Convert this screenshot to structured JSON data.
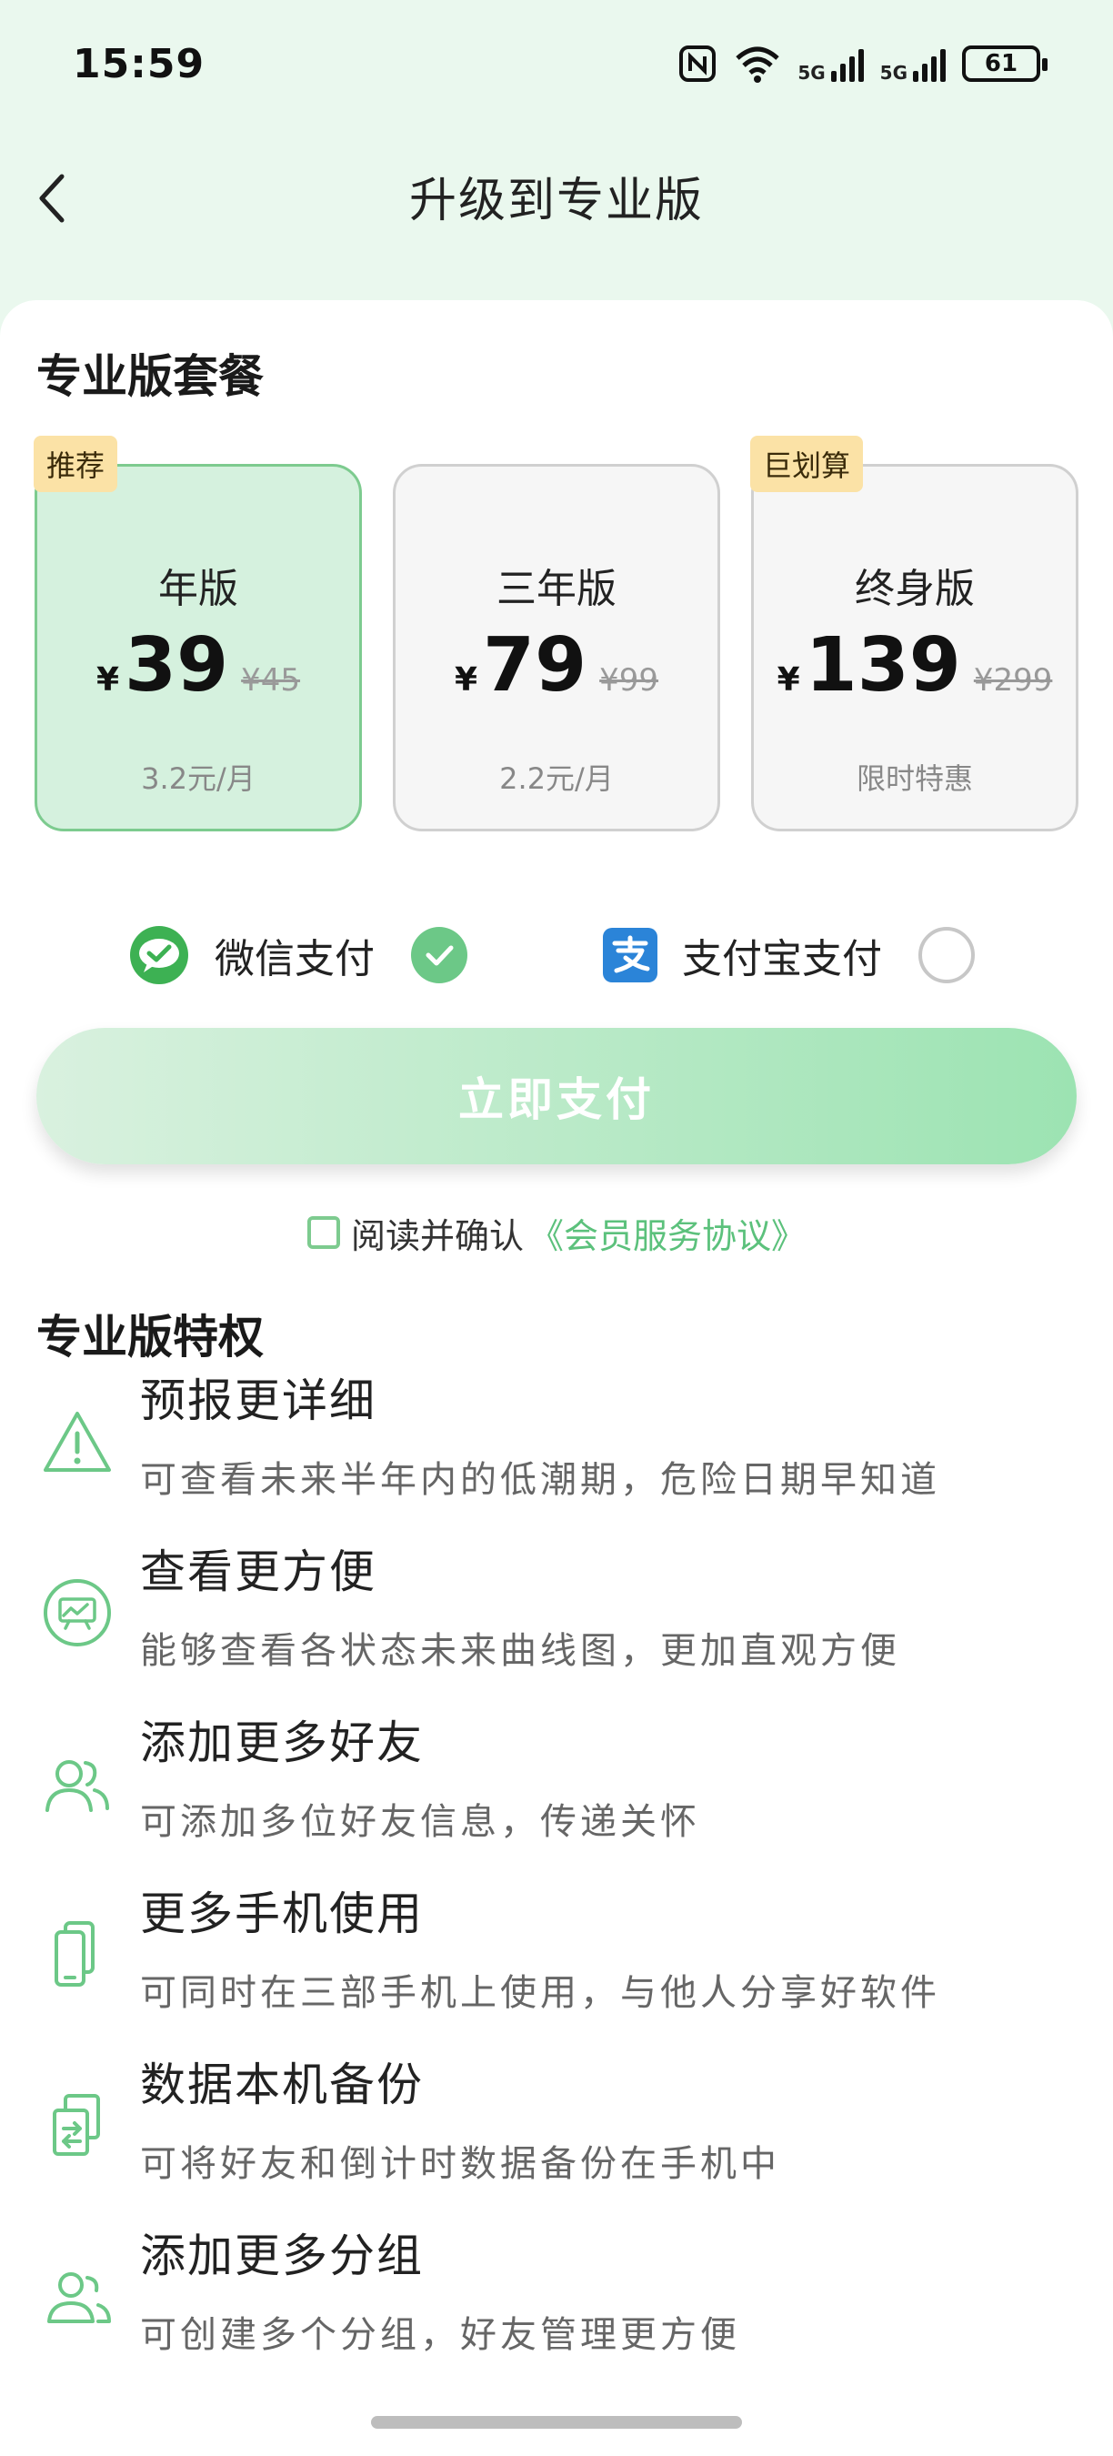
{
  "status_bar": {
    "time": "15:59",
    "nfc_icon": "nfc-icon",
    "wifi_icon": "wifi-icon",
    "signal_label_1": "5G",
    "signal_label_2": "5G",
    "battery_level": "61"
  },
  "header": {
    "title": "升级到专业版",
    "back_icon": "chevron-left-icon"
  },
  "plans_section": {
    "title": "专业版套餐",
    "plans": [
      {
        "name": "年版",
        "currency": "¥",
        "price": "39",
        "original_price": "¥45",
        "note": "3.2元/月",
        "tag": "推荐",
        "selected": true
      },
      {
        "name": "三年版",
        "currency": "¥",
        "price": "79",
        "original_price": "¥99",
        "note": "2.2元/月",
        "tag": "",
        "selected": false
      },
      {
        "name": "终身版",
        "currency": "¥",
        "price": "139",
        "original_price": "¥299",
        "note": "限时特惠",
        "tag": "巨划算",
        "selected": false
      }
    ]
  },
  "payments": {
    "wechat": {
      "label": "微信支付",
      "icon": "wechat-icon",
      "selected": true
    },
    "alipay": {
      "label": "支付宝支付",
      "icon": "alipay-icon",
      "selected": false
    }
  },
  "pay_button": {
    "label": "立即支付"
  },
  "agreement": {
    "text": "阅读并确认",
    "link": "《会员服务协议》"
  },
  "privileges_section": {
    "title": "专业版特权",
    "items": [
      {
        "title": "预报更详细",
        "desc": "可查看未来半年内的低潮期，危险日期早知道",
        "icon": "warning-triangle-icon"
      },
      {
        "title": "查看更方便",
        "desc": "能够查看各状态未来曲线图，更加直观方便",
        "icon": "chart-board-icon"
      },
      {
        "title": "添加更多好友",
        "desc": "可添加多位好友信息，传递关怀",
        "icon": "users-icon"
      },
      {
        "title": "更多手机使用",
        "desc": "可同时在三部手机上使用，与他人分享好软件",
        "icon": "phones-icon"
      },
      {
        "title": "数据本机备份",
        "desc": "可将好友和倒计时数据备份在手机中",
        "icon": "backup-icon"
      },
      {
        "title": "添加更多分组",
        "desc": "可创建多个分组，好友管理更方便",
        "icon": "group-icon"
      }
    ]
  },
  "colors": {
    "accent": "#6CC887",
    "background": "#EAF8EE",
    "tag_bg": "#FBE2A6"
  }
}
